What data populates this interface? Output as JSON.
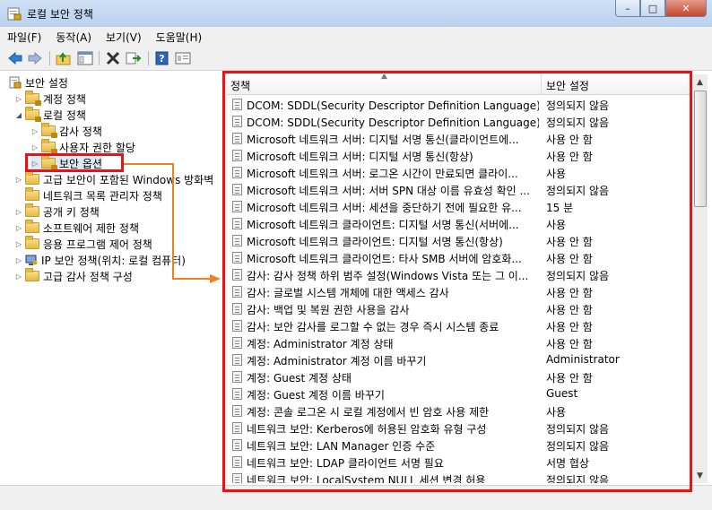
{
  "window": {
    "title": "로컬 보안 정책",
    "minimize": "–",
    "maximize": "□",
    "close": "✕"
  },
  "menu": [
    "파일(F)",
    "동작(A)",
    "보기(V)",
    "도움말(H)"
  ],
  "toolbar_icons": [
    "back-icon",
    "forward-icon",
    "up-folder-icon",
    "show-hide-tree-icon",
    "delete-icon",
    "export-icon",
    "help-icon",
    "properties-icon"
  ],
  "tree": {
    "root": "보안 설정",
    "nodes": [
      {
        "label": "계정 정책"
      },
      {
        "label": "로컬 정책"
      },
      {
        "label": "감사 정책"
      },
      {
        "label": "사용자 권한 할당"
      },
      {
        "label": "보안 옵션"
      },
      {
        "label": "고급 보안이 포함된 Windows 방화벽"
      },
      {
        "label": "네트워크 목록 관리자 정책"
      },
      {
        "label": "공개 키 정책"
      },
      {
        "label": "소프트웨어 제한 정책"
      },
      {
        "label": "응용 프로그램 제어 정책"
      },
      {
        "label": "IP 보안 정책(위치: 로컬 컴퓨터)"
      },
      {
        "label": "고급 감사 정책 구성"
      }
    ]
  },
  "list": {
    "col_policy": "정책",
    "col_setting": "보안 설정",
    "rows": [
      {
        "policy": "DCOM: SDDL(Security Descriptor Definition Language) 구...",
        "value": "정의되지 않음"
      },
      {
        "policy": "DCOM: SDDL(Security Descriptor Definition Language) 구...",
        "value": "정의되지 않음"
      },
      {
        "policy": "Microsoft 네트워크 서버: 디지털 서명 통신(클라이언트에...",
        "value": "사용 안 함"
      },
      {
        "policy": "Microsoft 네트워크 서버: 디지털 서명 통신(항상)",
        "value": "사용 안 함"
      },
      {
        "policy": "Microsoft 네트워크 서버: 로그온 시간이 만료되면 클라이...",
        "value": "사용"
      },
      {
        "policy": "Microsoft 네트워크 서버: 서버 SPN 대상 이름 유효성 확인 ...",
        "value": "정의되지 않음"
      },
      {
        "policy": "Microsoft 네트워크 서버: 세션을 중단하기 전에 필요한 유...",
        "value": "15 분"
      },
      {
        "policy": "Microsoft 네트워크 클라이언트: 디지털 서명 통신(서버에...",
        "value": "사용"
      },
      {
        "policy": "Microsoft 네트워크 클라이언트: 디지털 서명 통신(항상)",
        "value": "사용 안 함"
      },
      {
        "policy": "Microsoft 네트워크 클라이언트: 타사 SMB 서버에 암호화...",
        "value": "사용 안 함"
      },
      {
        "policy": "감사: 감사 정책 하위 범주 설정(Windows Vista 또는 그 이...",
        "value": "정의되지 않음"
      },
      {
        "policy": "감사: 글로벌 시스템 개체에 대한 액세스 감사",
        "value": "사용 안 함"
      },
      {
        "policy": "감사: 백업 및 복원 권한 사용을 감사",
        "value": "사용 안 함"
      },
      {
        "policy": "감사: 보안 감사를 로그할 수 없는 경우 즉시 시스템 종료",
        "value": "사용 안 함"
      },
      {
        "policy": "계정: Administrator 계정 상태",
        "value": "사용 안 함"
      },
      {
        "policy": "계정: Administrator 계정 이름 바꾸기",
        "value": "Administrator"
      },
      {
        "policy": "계정: Guest 계정 상태",
        "value": "사용 안 함"
      },
      {
        "policy": "계정: Guest 계정 이름 바꾸기",
        "value": "Guest"
      },
      {
        "policy": "계정: 콘솔 로그온 시 로컬 계정에서 빈 암호 사용 제한",
        "value": "사용"
      },
      {
        "policy": "네트워크 보안: Kerberos에 허용된 암호화 유형 구성",
        "value": "정의되지 않음"
      },
      {
        "policy": "네트워크 보안: LAN Manager 인증 수준",
        "value": "정의되지 않음"
      },
      {
        "policy": "네트워크 보안: LDAP 클라이언트 서명 필요",
        "value": "서명 협상"
      },
      {
        "policy": "네트워크 보안: LocalSystem NULL 세션 변경 허용",
        "value": "정의되지 않음"
      }
    ]
  },
  "colors": {
    "highlight": "#e11111",
    "arrow": "#f08020"
  }
}
